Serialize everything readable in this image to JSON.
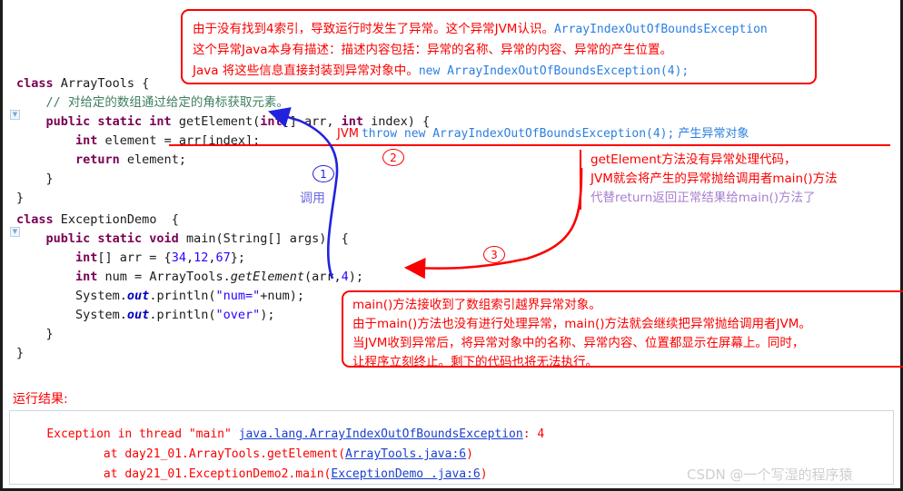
{
  "code_block_1": {
    "lines": [
      [
        {
          "t": "class ",
          "c": "kw"
        },
        {
          "t": "ArrayTools {",
          "c": "pln"
        }
      ],
      [
        {
          "t": "    // 对给定的数组通过给定的角标获取元素。",
          "c": "cmt"
        }
      ],
      [
        {
          "t": "    public static int ",
          "c": "kw"
        },
        {
          "t": "getElement(",
          "c": "pln"
        },
        {
          "t": "int",
          "c": "kw"
        },
        {
          "t": "[] arr, ",
          "c": "pln"
        },
        {
          "t": "int",
          "c": "kw"
        },
        {
          "t": " index) {",
          "c": "pln"
        }
      ],
      [
        {
          "t": "        int ",
          "c": "kw"
        },
        {
          "t": "element = arr[index];",
          "c": "pln"
        }
      ],
      [
        {
          "t": "        return ",
          "c": "kw"
        },
        {
          "t": "element;",
          "c": "pln"
        }
      ],
      [
        {
          "t": "    }",
          "c": "pln"
        }
      ],
      [
        {
          "t": "}",
          "c": "pln"
        }
      ]
    ]
  },
  "code_block_2": {
    "lines": [
      [
        {
          "t": "class ",
          "c": "kw"
        },
        {
          "t": "ExceptionDemo  {",
          "c": "pln"
        }
      ],
      [
        {
          "t": "    public static void ",
          "c": "kw"
        },
        {
          "t": "main(String[] args)  {",
          "c": "pln"
        }
      ],
      [
        {
          "t": "        int",
          "c": "kw"
        },
        {
          "t": "[] arr = {",
          "c": "pln"
        },
        {
          "t": "34",
          "c": "num"
        },
        {
          "t": ",",
          "c": "pln"
        },
        {
          "t": "12",
          "c": "num"
        },
        {
          "t": ",",
          "c": "pln"
        },
        {
          "t": "67",
          "c": "num"
        },
        {
          "t": "};",
          "c": "pln"
        }
      ],
      [
        {
          "t": "        int ",
          "c": "kw"
        },
        {
          "t": "num = ArrayTools.",
          "c": "pln"
        },
        {
          "t": "getElement",
          "c": "mth"
        },
        {
          "t": "(arr,",
          "c": "pln"
        },
        {
          "t": "4",
          "c": "num"
        },
        {
          "t": ");",
          "c": "pln"
        }
      ],
      [
        {
          "t": "        System.",
          "c": "pln"
        },
        {
          "t": "out",
          "c": "fld"
        },
        {
          "t": ".println(",
          "c": "pln"
        },
        {
          "t": "\"num=\"",
          "c": "str"
        },
        {
          "t": "+num);",
          "c": "pln"
        }
      ],
      [
        {
          "t": "        System.",
          "c": "pln"
        },
        {
          "t": "out",
          "c": "fld"
        },
        {
          "t": ".println(",
          "c": "pln"
        },
        {
          "t": "\"over\"",
          "c": "str"
        },
        {
          "t": ");",
          "c": "pln"
        }
      ],
      [
        {
          "t": "    }",
          "c": "pln"
        }
      ],
      [
        {
          "t": "}",
          "c": "pln"
        }
      ]
    ]
  },
  "annotations": {
    "top_note": {
      "line1_cn": "由于没有找到4索引，导致运行时发生了异常。这个异常JVM认识。",
      "line1_code": "ArrayIndexOutOfBoundsException",
      "line2": "这个异常Java本身有描述：描述内容包括：异常的名称、异常的内容、异常的产生位置。",
      "line3_cn": "Java 将这些信息直接封装到异常对象中。",
      "line3_code": "new ArrayIndexOutOfBoundsException(4);"
    },
    "throw_line": {
      "prefix": "JVM",
      "code": "throw new ArrayIndexOutOfBoundsException(4);",
      "suffix": "产生异常对象"
    },
    "right_note": {
      "line1": "getElement方法没有异常处理代码，",
      "line2": "JVM就会将产生的异常抛给调用者main()方法",
      "line3": "代替return返回正常结果给main()方法了"
    },
    "bottom_note": {
      "line1": "main()方法接收到了数组索引越界异常对象。",
      "line2": "由于main()方法也没有进行处理异常，main()方法就会继续把异常抛给调用者JVM。",
      "line3": "当JVM收到异常后，将异常对象中的名称、异常内容、位置都显示在屏幕上。同时，",
      "line4": "让程序立刻终止。剩下的代码也将无法执行。"
    },
    "marker1": "1",
    "marker2": "2",
    "marker3": "3",
    "call_label": "调用"
  },
  "result": {
    "label": "运行结果:",
    "line1": {
      "head": "Exception in thread \"main\" ",
      "link": "java.lang.ArrayIndexOutOfBoundsException",
      "tail": ": 4"
    },
    "line2": {
      "head": "        at day21_01.ArrayTools.getElement(",
      "link": "ArrayTools.java:6",
      "tail": ")"
    },
    "line3": {
      "head": "        at day21_01.ExceptionDemo2.main(",
      "link": "ExceptionDemo .java:6",
      "tail": ")"
    }
  },
  "watermark": "CSDN @一个写湿的程序猿",
  "colors": {
    "annotation_red": "#fa0000",
    "link_blue": "#1a3fd0",
    "code_blue": "#2a7fe0",
    "keyword_purple": "#7a0052",
    "comment_green": "#3f7f5f",
    "string_blue": "#2a00ff",
    "marker_blue": "#2222dd",
    "violet": "#a87fd0",
    "watermark_gray": "#cfcfcf"
  }
}
